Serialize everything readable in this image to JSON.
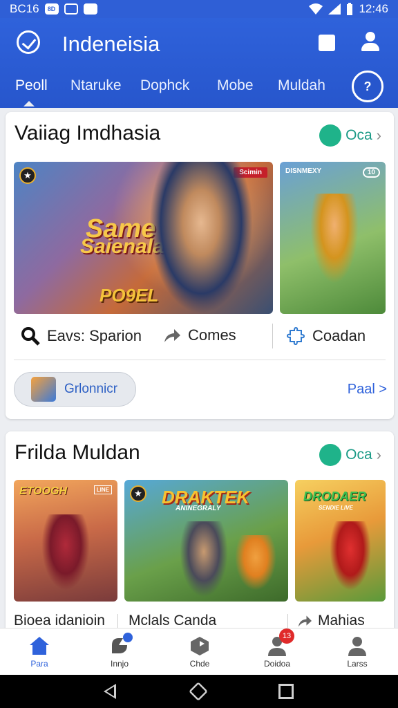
{
  "status_bar": {
    "left_text": "BC16",
    "badge1": "8D",
    "time": "12:46"
  },
  "app_bar": {
    "title": "Indeneisia",
    "help_label": "?"
  },
  "tabs": [
    {
      "label": "Peoll"
    },
    {
      "label": "Ntaruke"
    },
    {
      "label": "Dophck"
    },
    {
      "label": "Mobe"
    },
    {
      "label": "Muldah"
    }
  ],
  "section1": {
    "title": "Vaiiag Imdhasia",
    "badge_text": "Oca",
    "thumb1": {
      "corner_tag": "Scimin",
      "title_line1": "Same",
      "title_line2": "Saienala",
      "subtitle": "PO9EL"
    },
    "thumb2": {
      "corner_tag": "DISNMEXY",
      "counter": "10"
    },
    "actions": [
      {
        "label": "Eavs: Sparion",
        "icon": "search-icon"
      },
      {
        "label": "Comes",
        "icon": "share-icon"
      },
      {
        "label": "Coadan",
        "icon": "puzzle-icon"
      }
    ],
    "chip_label": "Grlonnicr",
    "more_link": "Paal >"
  },
  "section2": {
    "title": "Frilda Muldan",
    "badge_text": "Oca",
    "thumbs": [
      {
        "title": "ETOOGH",
        "tag": "LINE"
      },
      {
        "title": "DRAKTEK",
        "subtitle": "ANINEGRALY"
      },
      {
        "title": "DRODAER",
        "subtitle": "SENDIE LIVE"
      }
    ],
    "row_labels": [
      "Bioea idanioin",
      "Mclals Canda",
      "Mahias"
    ]
  },
  "bottom_nav": [
    {
      "label": "Para",
      "icon": "home-icon",
      "active": true
    },
    {
      "label": "Innjo",
      "icon": "puzzle-icon"
    },
    {
      "label": "Chde",
      "icon": "cube-icon"
    },
    {
      "label": "Doidoa",
      "icon": "person-icon",
      "notification": "13"
    },
    {
      "label": "Larss",
      "icon": "person-icon"
    }
  ],
  "colors": {
    "primary": "#2f62db",
    "accent_green": "#1fb38a",
    "badge_red": "#e02a2a"
  }
}
